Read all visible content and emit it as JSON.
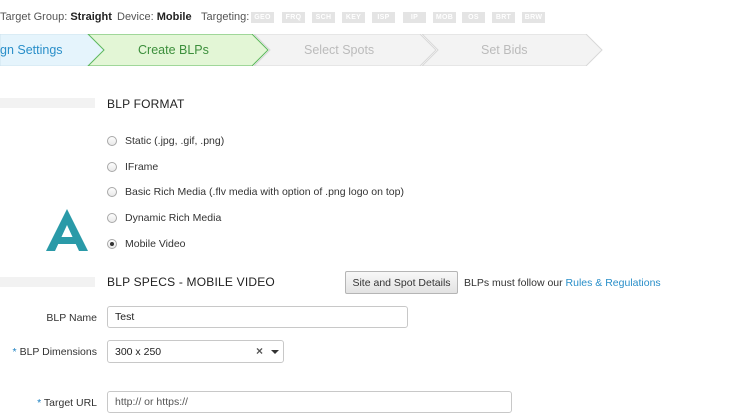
{
  "topbar": {
    "target_group_label": "Target Group:",
    "target_group_value": "Straight",
    "device_label": "Device:",
    "device_value": "Mobile",
    "targeting_label": "Targeting:",
    "tags": [
      "GEO",
      "FRQ",
      "SCH",
      "KEY",
      "ISP",
      "IP",
      "MOB",
      "OS",
      "BRT",
      "BRW"
    ]
  },
  "steps": [
    {
      "label": "gn Settings",
      "state": "done"
    },
    {
      "label": "Create BLPs",
      "state": "active"
    },
    {
      "label": "Select Spots",
      "state": "pending"
    },
    {
      "label": "Set Bids",
      "state": "pending"
    }
  ],
  "format": {
    "title": "BLP FORMAT",
    "options": [
      {
        "label": "Static (.jpg, .gif, .png)",
        "checked": false
      },
      {
        "label": "IFrame",
        "checked": false
      },
      {
        "label": "Basic Rich Media (.flv media with option of .png logo on top)",
        "checked": false
      },
      {
        "label": "Dynamic Rich Media",
        "checked": false
      },
      {
        "label": "Mobile Video",
        "checked": true
      }
    ]
  },
  "specs": {
    "title": "BLP SPECS - MOBILE VIDEO",
    "details_button": "Site and Spot Details",
    "rules_prefix": "BLPs must follow our",
    "rules_link": "Rules & Regulations"
  },
  "form": {
    "name_label": "BLP Name",
    "name_value": "Test",
    "dimensions_label": "BLP Dimensions",
    "dimensions_value": "300 x 250",
    "dimensions_clear": "×",
    "url_label": "Target URL",
    "url_placeholder": "http:// or https://",
    "required_mark": "*"
  },
  "colors": {
    "active_step_fill": "#e3f6d6",
    "active_step_border": "#5cb85c",
    "active_step_text": "#3c8f3c",
    "done_step_fill": "#e5f4fc",
    "done_step_text": "#2a8fc9",
    "pending_step_fill": "#f3f3f3",
    "pending_step_text": "#bbbbbb",
    "logo": "#2a9aa8",
    "link": "#2a8fc9"
  }
}
